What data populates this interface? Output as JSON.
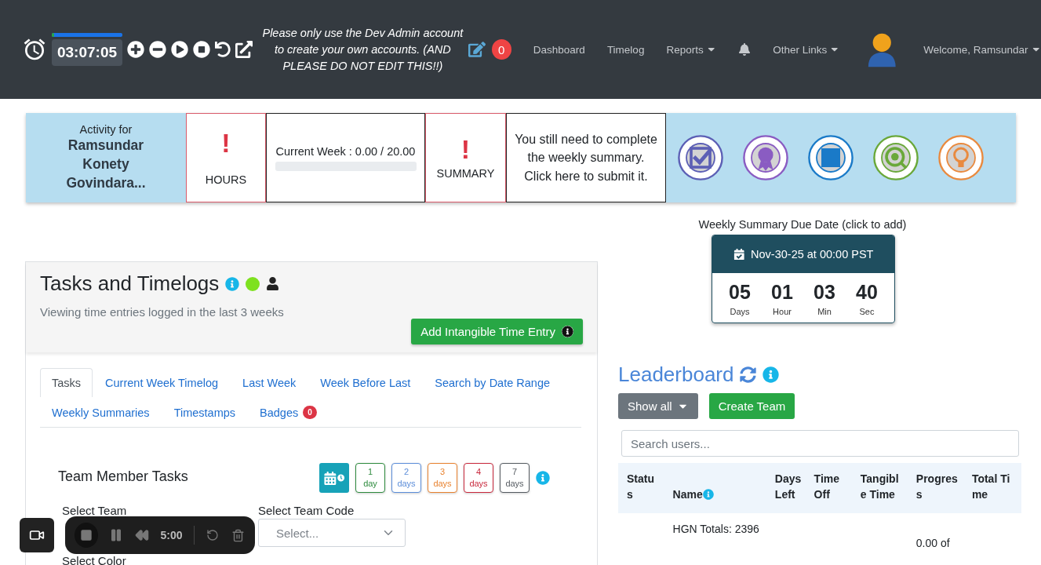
{
  "header": {
    "timer": {
      "time": "03:07:05",
      "level": 0.03
    },
    "notice": "Please only use the Dev Admin account to create your own accounts. (AND PLEASE DO NOT EDIT THIS!!)",
    "notification_count": "0",
    "nav": [
      {
        "kind": "link",
        "label": "Dashboard"
      },
      {
        "kind": "link",
        "label": "Timelog"
      },
      {
        "kind": "dropdown",
        "label": "Reports"
      },
      {
        "kind": "bell"
      },
      {
        "kind": "dropdown",
        "label": "Other Links"
      }
    ],
    "user_menu": "Welcome, Ramsundar"
  },
  "activity": {
    "caption": "Activity for",
    "name": "Ramsundar Konety Govindara...",
    "hours_alert": "!",
    "hours_label": "HOURS",
    "current_week": "Current Week : 0.00 / 20.00",
    "week_progress": {
      "level": 0
    },
    "summary_alert": "!",
    "summary_label": "SUMMARY",
    "summary_message": "You still need to complete the weekly summary. Click here to submit it.",
    "badges": [
      {
        "kind": "tasks",
        "color": "#5c5fb5"
      },
      {
        "kind": "badges",
        "color": "#8a5cc2"
      },
      {
        "kind": "blue_square",
        "color": "#1a7ac8"
      },
      {
        "kind": "report",
        "color": "#6aa83a"
      },
      {
        "kind": "suggestions",
        "color": "#e98a3f"
      }
    ]
  },
  "due_date": {
    "title": "Weekly Summary Due Date (click to add)",
    "date": "Nov-30-25 at 00:00 PST",
    "countdown": [
      {
        "value": "05",
        "unit": "Days"
      },
      {
        "value": "01",
        "unit": "Hour"
      },
      {
        "value": "03",
        "unit": "Min"
      },
      {
        "value": "40",
        "unit": "Sec"
      }
    ]
  },
  "tasks_panel": {
    "title": "Tasks and Timelogs",
    "online": true,
    "subtitle": "Viewing time entries logged in the last 3 weeks",
    "add_button": "Add Intangible Time Entry",
    "tabs": [
      {
        "label": "Tasks",
        "selected": true
      },
      {
        "label": "Current Week Timelog",
        "selected": false
      },
      {
        "label": "Last Week",
        "selected": false
      },
      {
        "label": "Week Before Last",
        "selected": false
      },
      {
        "label": "Search by Date Range",
        "selected": false
      },
      {
        "label": "Weekly Summaries",
        "selected": false
      },
      {
        "label": "Timestamps",
        "selected": false
      },
      {
        "label": "Badges",
        "selected": false,
        "badge": "0"
      }
    ],
    "team_tasks": {
      "title": "Team Member Tasks",
      "ranges": [
        {
          "number": "1",
          "unit": "day",
          "color": "#2e8b3e"
        },
        {
          "number": "2",
          "unit": "days",
          "color": "#5b8dd9"
        },
        {
          "number": "3",
          "unit": "days",
          "color": "#e8822f"
        },
        {
          "number": "4",
          "unit": "days",
          "color": "#c8283c"
        },
        {
          "number": "7",
          "unit": "days",
          "color": "#555b61"
        }
      ],
      "select_team_label": "Select Team",
      "select_team_code_label": "Select Team Code",
      "team_code_placeholder": "Select...",
      "select_color_label": "Select Color"
    }
  },
  "leaderboard": {
    "title": "Leaderboard",
    "filter": "Show all",
    "create_button": "Create Team",
    "search_placeholder": "Search users...",
    "columns": [
      "Status",
      "Name",
      "Days Left",
      "Time Off",
      "Tangible Time",
      "Progress",
      "Total Time"
    ],
    "rows": [
      {
        "name": "HGN Totals: 2396",
        "progress": "0.00 of"
      }
    ]
  },
  "recorder": {
    "time": "5:00"
  }
}
